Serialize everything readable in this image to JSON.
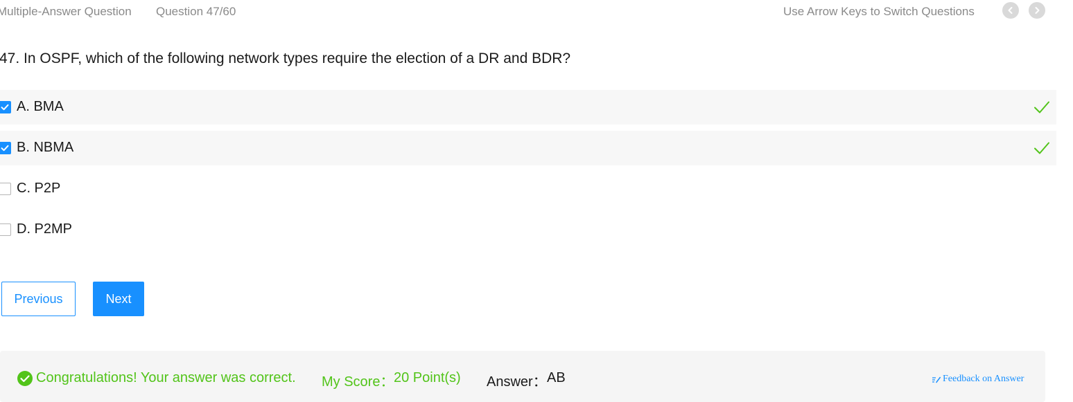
{
  "header": {
    "question_type": "Multiple-Answer Question",
    "question_count": "Question 47/60",
    "keyboard_hint": "Use Arrow Keys to Switch Questions"
  },
  "question": {
    "text": "47. In OSPF, which of the following network types require the election of a DR and BDR?",
    "options": [
      {
        "label": "A. BMA",
        "checked": true,
        "correct": true
      },
      {
        "label": "B. NBMA",
        "checked": true,
        "correct": true
      },
      {
        "label": "C. P2P",
        "checked": false,
        "correct": false
      },
      {
        "label": "D. P2MP",
        "checked": false,
        "correct": false
      }
    ]
  },
  "actions": {
    "previous_label": "Previous",
    "next_label": "Next"
  },
  "result": {
    "message": "Congratulations! Your answer was correct.",
    "score_label": "My Score：",
    "score_value": "20 Point(s)",
    "answer_label": "Answer：",
    "answer_value": "AB",
    "feedback_label": "Feedback on Answer"
  },
  "colors": {
    "accent": "#1890ff",
    "success": "#52c41a",
    "muted_text": "#8a8a8a",
    "nav_circle": "#d9d9d9"
  }
}
